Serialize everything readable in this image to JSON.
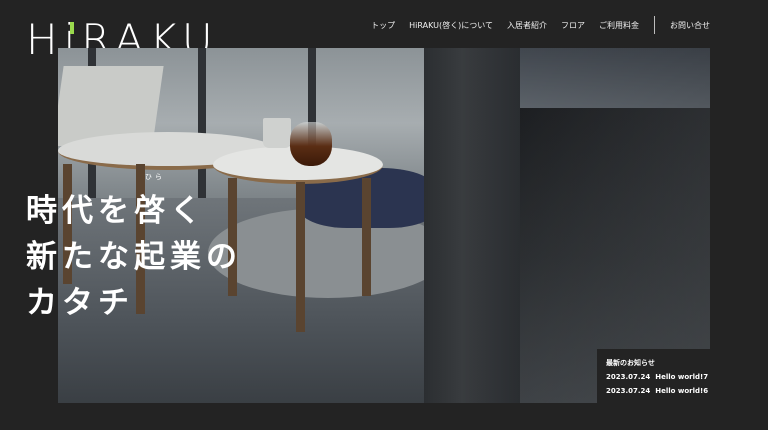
{
  "brand": {
    "logo_pre": "H",
    "logo_accent": "i",
    "logo_post": "RAKU"
  },
  "nav": {
    "items": [
      {
        "label": "トップ"
      },
      {
        "label": "HiRAKU(啓く)について"
      },
      {
        "label": "入居者紹介"
      },
      {
        "label": "フロア"
      },
      {
        "label": "ご利用料金"
      }
    ],
    "contact_label": "お問い合せ"
  },
  "hero": {
    "ruby": "ひら",
    "catch_lines": [
      "時代を啓く",
      "新たな起業の",
      "カタチ"
    ]
  },
  "news": {
    "title": "最新のお知らせ",
    "items": [
      {
        "date": "2023.07.24",
        "title": "Hello world!7"
      },
      {
        "date": "2023.07.24",
        "title": "Hello world!6"
      }
    ]
  },
  "colors": {
    "background": "#232323",
    "logo_accent": "#9ad94d",
    "text": "#ffffff"
  }
}
